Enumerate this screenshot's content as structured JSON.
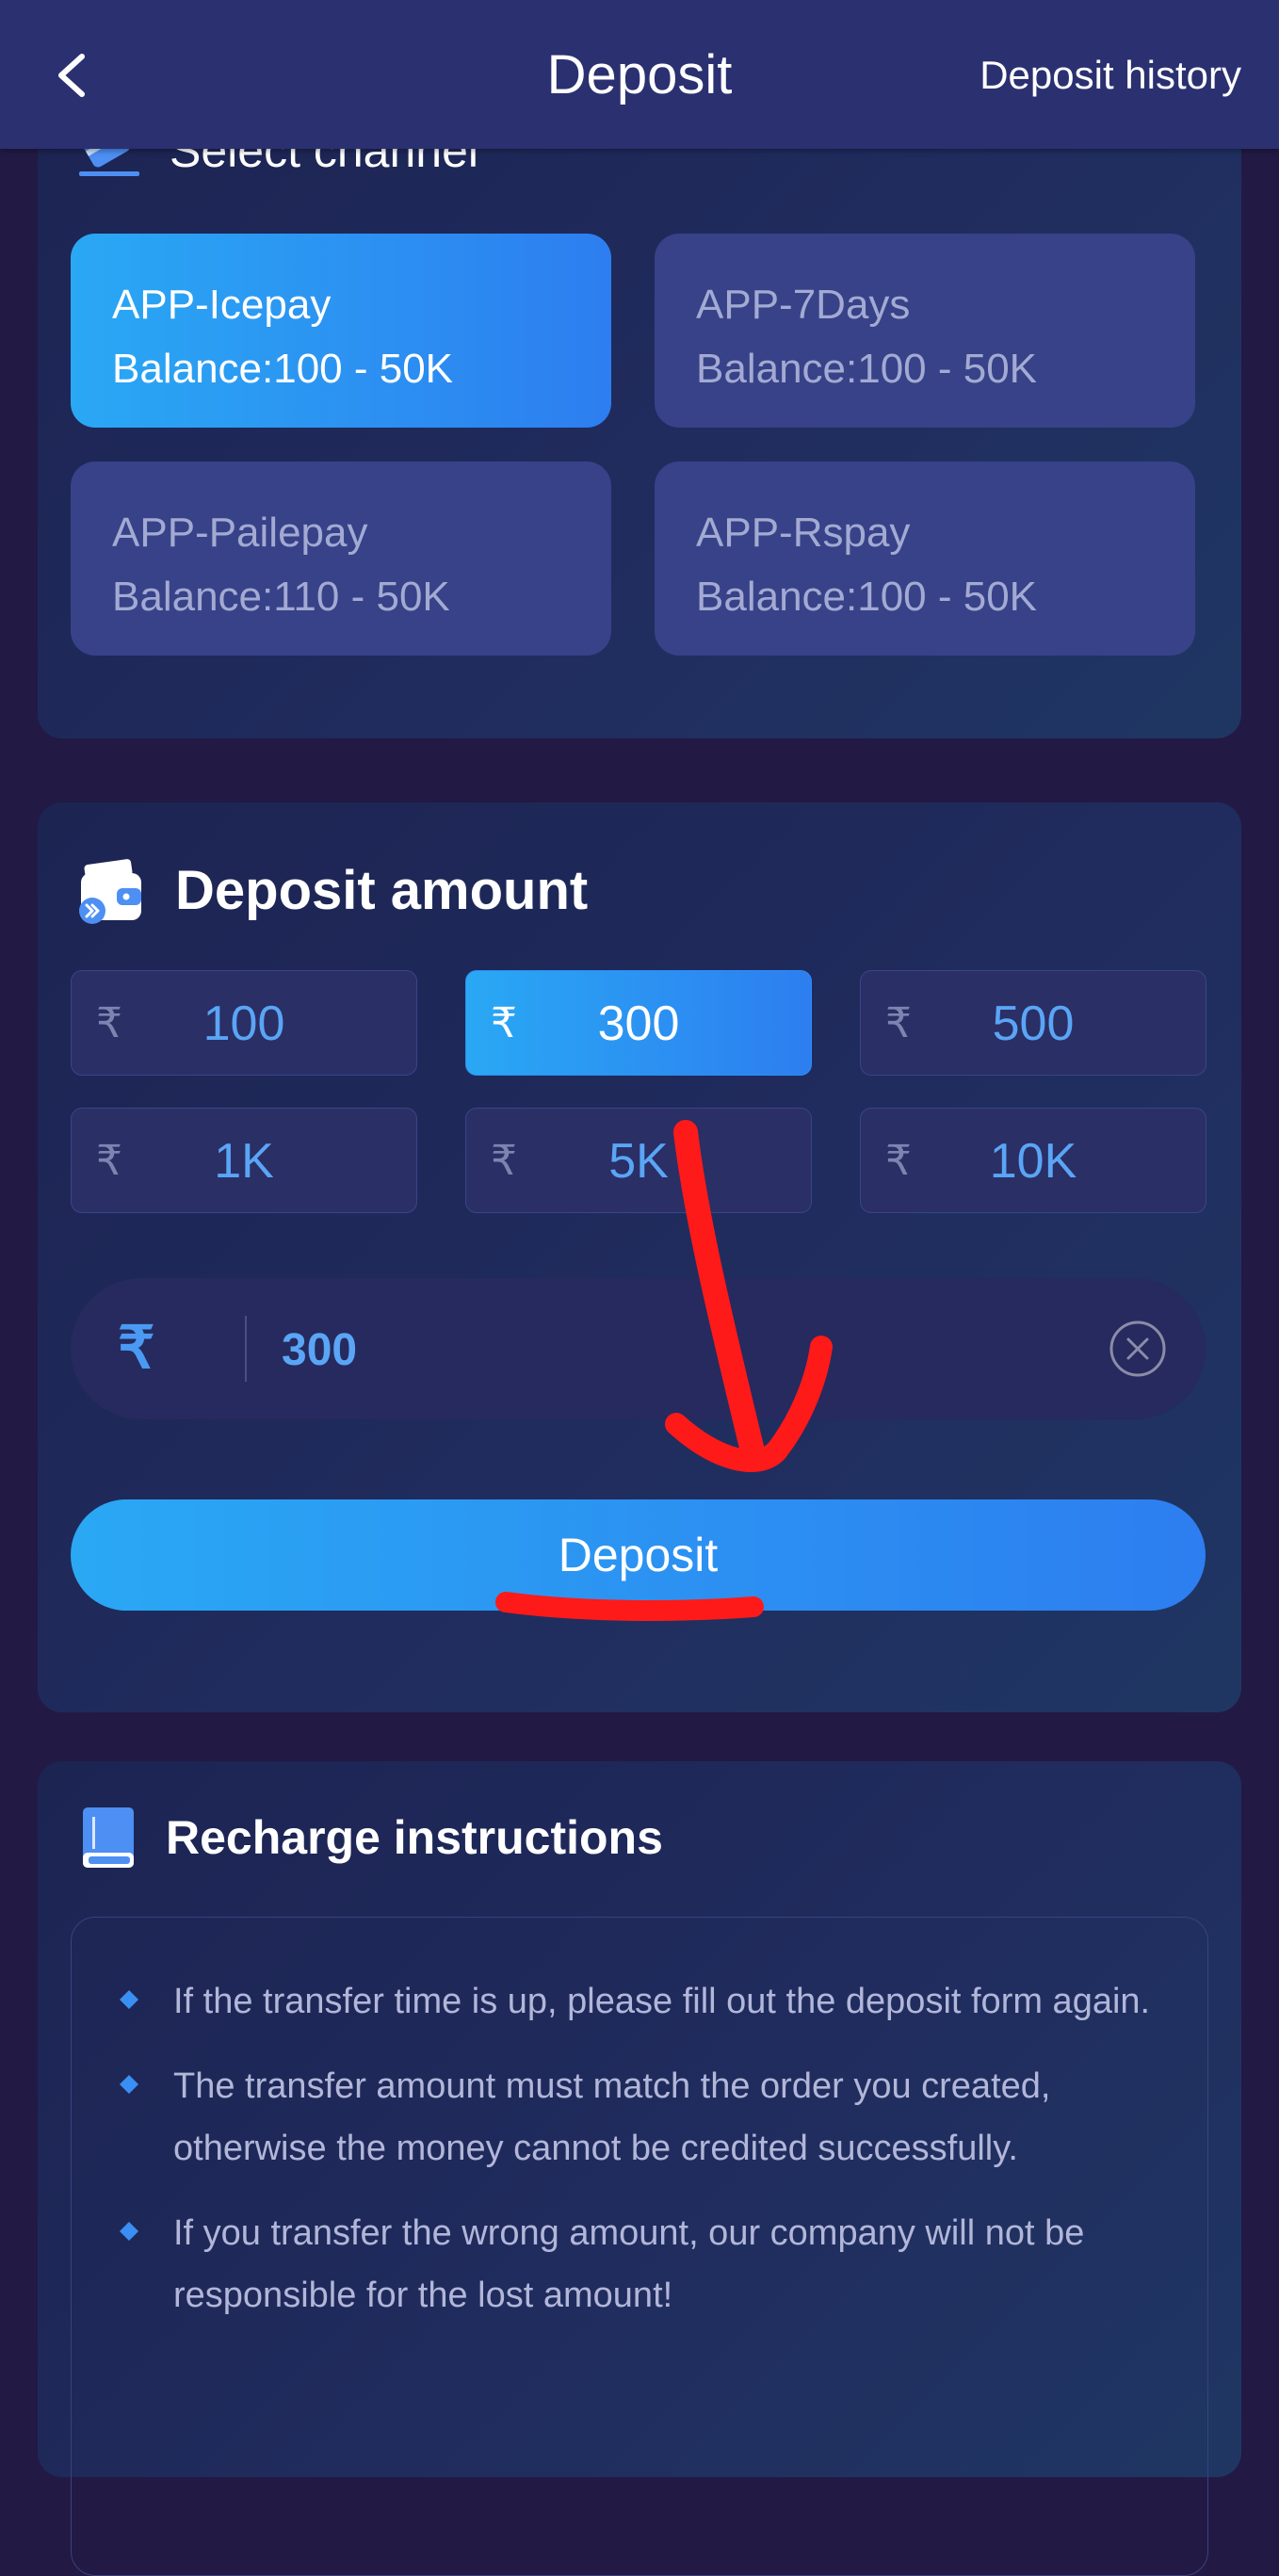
{
  "header": {
    "title": "Deposit",
    "history_label": "Deposit history",
    "back_icon": "chevron-left-icon"
  },
  "channel_section": {
    "title": "Select channel",
    "icon": "card-icon",
    "channels": [
      {
        "name": "APP-Icepay",
        "balance": "Balance:100 - 50K",
        "selected": true
      },
      {
        "name": "APP-7Days",
        "balance": "Balance:100 - 50K",
        "selected": false
      },
      {
        "name": "APP-Pailepay",
        "balance": "Balance:110 - 50K",
        "selected": false
      },
      {
        "name": "APP-Rspay",
        "balance": "Balance:100 - 50K",
        "selected": false
      }
    ]
  },
  "amount_section": {
    "title": "Deposit amount",
    "icon": "wallet-icon",
    "currency_symbol": "₹",
    "presets": [
      {
        "label": "100",
        "selected": false
      },
      {
        "label": "300",
        "selected": true
      },
      {
        "label": "500",
        "selected": false
      },
      {
        "label": "1K",
        "selected": false
      },
      {
        "label": "5K",
        "selected": false
      },
      {
        "label": "10K",
        "selected": false
      }
    ],
    "input_value": "300",
    "deposit_button_label": "Deposit"
  },
  "instructions_section": {
    "title": "Recharge instructions",
    "icon": "book-icon",
    "items": [
      "If the transfer time is up, please fill out the deposit form again.",
      "The transfer amount must match the order you created, otherwise the money cannot be credited successfully.",
      "If you transfer the wrong amount, our company will not be responsible for the lost amount!"
    ]
  },
  "colors": {
    "background": "#221a44",
    "header": "#2b3071",
    "accent_start": "#2aa8f4",
    "accent_end": "#2d7ef0",
    "annotation": "#ff1a1a"
  }
}
